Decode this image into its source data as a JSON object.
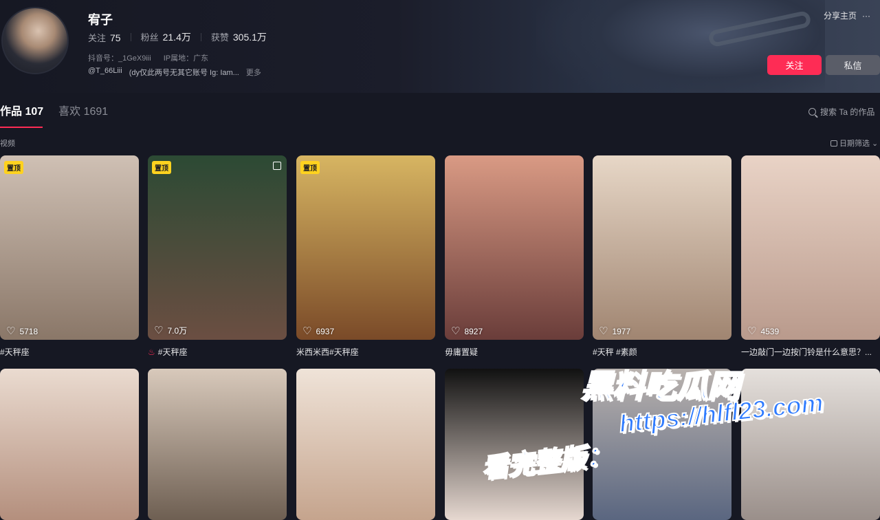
{
  "profile": {
    "name": "宥子",
    "stats": [
      {
        "label": "关注",
        "value": "75"
      },
      {
        "label": "粉丝",
        "value": "21.4万"
      },
      {
        "label": "获赞",
        "value": "305.1万"
      }
    ],
    "douyin_id": "抖音号：_1GeX9iii",
    "ip_location": "IP属地：广东",
    "bio_handle": "@T_66Liii",
    "bio_text": "(dy仅此两号无其它账号 Ig: Iam...",
    "bio_more": "更多"
  },
  "header": {
    "share_label": "分享主页",
    "more_label": "···",
    "follow_label": "关注",
    "message_label": "私信"
  },
  "tabs": [
    {
      "label": "作品 107"
    },
    {
      "label": "喜欢 1691"
    }
  ],
  "search": {
    "label": "搜索 Ta 的作品"
  },
  "section": {
    "label": "视频",
    "filter_label": "日期筛选"
  },
  "videos": [
    {
      "pinned": true,
      "pin_label": "置顶",
      "likes": "5718",
      "caption": "#天秤座",
      "colors": [
        "#cfc0b4",
        "#8a7768"
      ]
    },
    {
      "pinned": true,
      "pin_label": "置顶",
      "likes": "7.0万",
      "caption": "#天秤座",
      "fire": true,
      "multi": true,
      "colors": [
        "#2c4a34",
        "#6b4e42"
      ]
    },
    {
      "pinned": true,
      "pin_label": "置顶",
      "likes": "6937",
      "caption": "米西米西#天秤座",
      "colors": [
        "#d7b562",
        "#7a4a28"
      ]
    },
    {
      "pinned": false,
      "likes": "8927",
      "caption": "毋庸置疑",
      "colors": [
        "#d99a84",
        "#6a3d3a"
      ]
    },
    {
      "pinned": false,
      "likes": "1977",
      "caption": "#天秤 #素颜",
      "colors": [
        "#e7d7c7",
        "#a08571"
      ]
    },
    {
      "pinned": false,
      "likes": "4539",
      "caption": "一边敲门一边按门铃是什么意思？...",
      "colors": [
        "#e9d3c6",
        "#b99a8c"
      ]
    },
    {
      "colors": [
        "#eadbd0",
        "#b48f7d"
      ]
    },
    {
      "colors": [
        "#d8c9bb",
        "#6e5f52"
      ]
    },
    {
      "colors": [
        "#efe3d8",
        "#c5a48d"
      ]
    },
    {
      "colors": [
        "#111111",
        "#e6d8d0"
      ]
    },
    {
      "colors": [
        "#b9b2ae",
        "#5a6680"
      ]
    },
    {
      "colors": [
        "#e5e0dc",
        "#9a8f8a"
      ]
    }
  ],
  "watermark": {
    "line1": "黑料吃瓜网",
    "line2": "https://hlfl23.com",
    "line3": "看完整版："
  }
}
